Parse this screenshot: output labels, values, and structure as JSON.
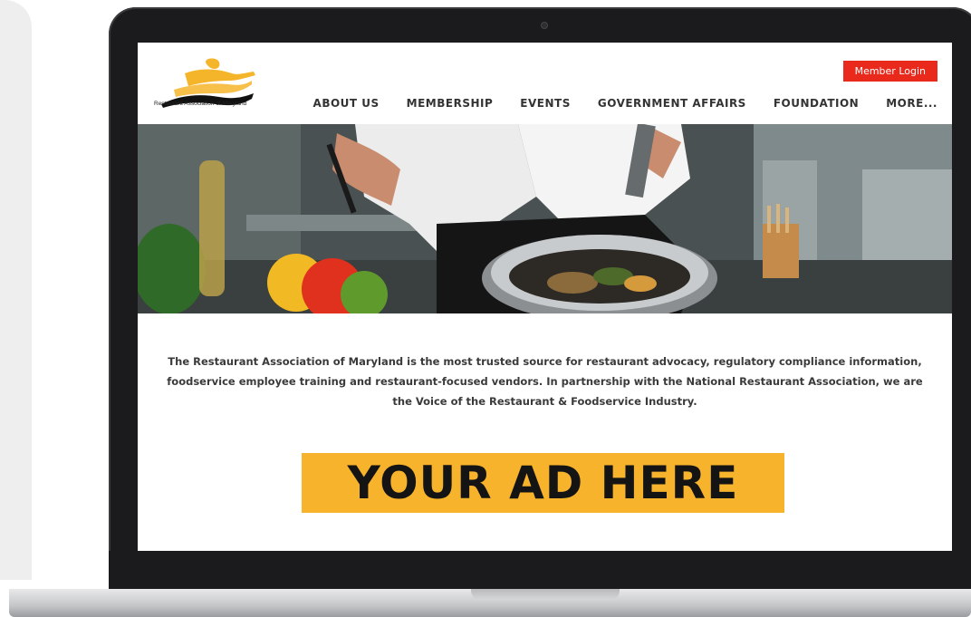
{
  "site": {
    "logo_text": "Restaurant Association of Maryland",
    "member_login": "Member Login",
    "nav": [
      "ABOUT US",
      "MEMBERSHIP",
      "EVENTS",
      "GOVERNMENT AFFAIRS",
      "FOUNDATION",
      "MORE..."
    ],
    "blurb": "The Restaurant Association of Maryland is the most trusted source for restaurant advocacy, regulatory compliance information, foodservice employee training and restaurant-focused vendors. In partnership with the National Restaurant Association, we are the Voice of the Restaurant & Foodservice Industry.",
    "ad_text": "YOUR AD HERE"
  },
  "colors": {
    "accent_red": "#e9291c",
    "ad_yellow": "#f7b32b",
    "logo_gold": "#f5b52a"
  },
  "hero": {
    "image_description_icon": "chef-cooking-pan-hero-image"
  }
}
